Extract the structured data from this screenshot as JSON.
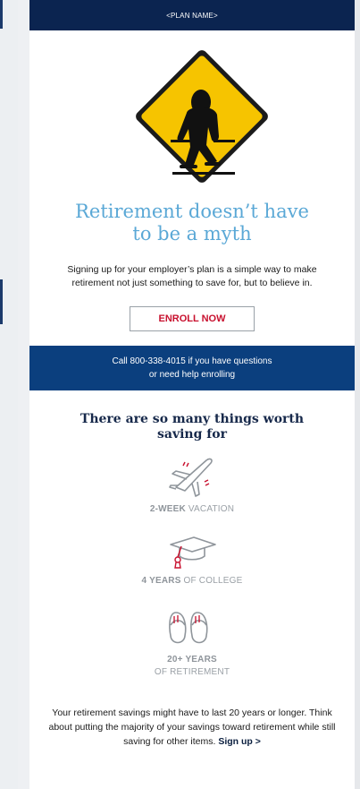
{
  "header": {
    "plan_name": "<PLAN NAME>"
  },
  "hero": {
    "headline_line1": "Retirement doesn’t have",
    "headline_line2": "to be a myth",
    "intro": "Signing up for your employer’s plan is a simple way to make retirement not just something to save for, but to believe in.",
    "enroll_label": "ENROLL NOW"
  },
  "callbar": {
    "line1": "Call 800-338-4015 if you have questions",
    "line2": "or need help enrolling"
  },
  "saving": {
    "title_line1": "There are so many things worth",
    "title_line2": "saving for",
    "items": [
      {
        "icon": "airplane-icon",
        "strong": "2-WEEK",
        "rest": "VACATION",
        "rest_line2": ""
      },
      {
        "icon": "graduation-cap-icon",
        "strong": "4 YEARS",
        "rest": "OF COLLEGE",
        "rest_line2": ""
      },
      {
        "icon": "slippers-icon",
        "strong": "20+ YEARS",
        "rest": "",
        "rest_line2": "OF RETIREMENT"
      }
    ]
  },
  "outro": {
    "text": "Your retirement savings might have to last 20 years or longer. Think about putting the majority of your savings toward retirement while still saving for other items.",
    "link": "Sign up >"
  },
  "colors": {
    "navy": "#0b2450",
    "blue_bar": "#0b3f7e",
    "headline": "#5aa8d6",
    "accent_red": "#c8102e",
    "sign_yellow": "#f6c400"
  }
}
